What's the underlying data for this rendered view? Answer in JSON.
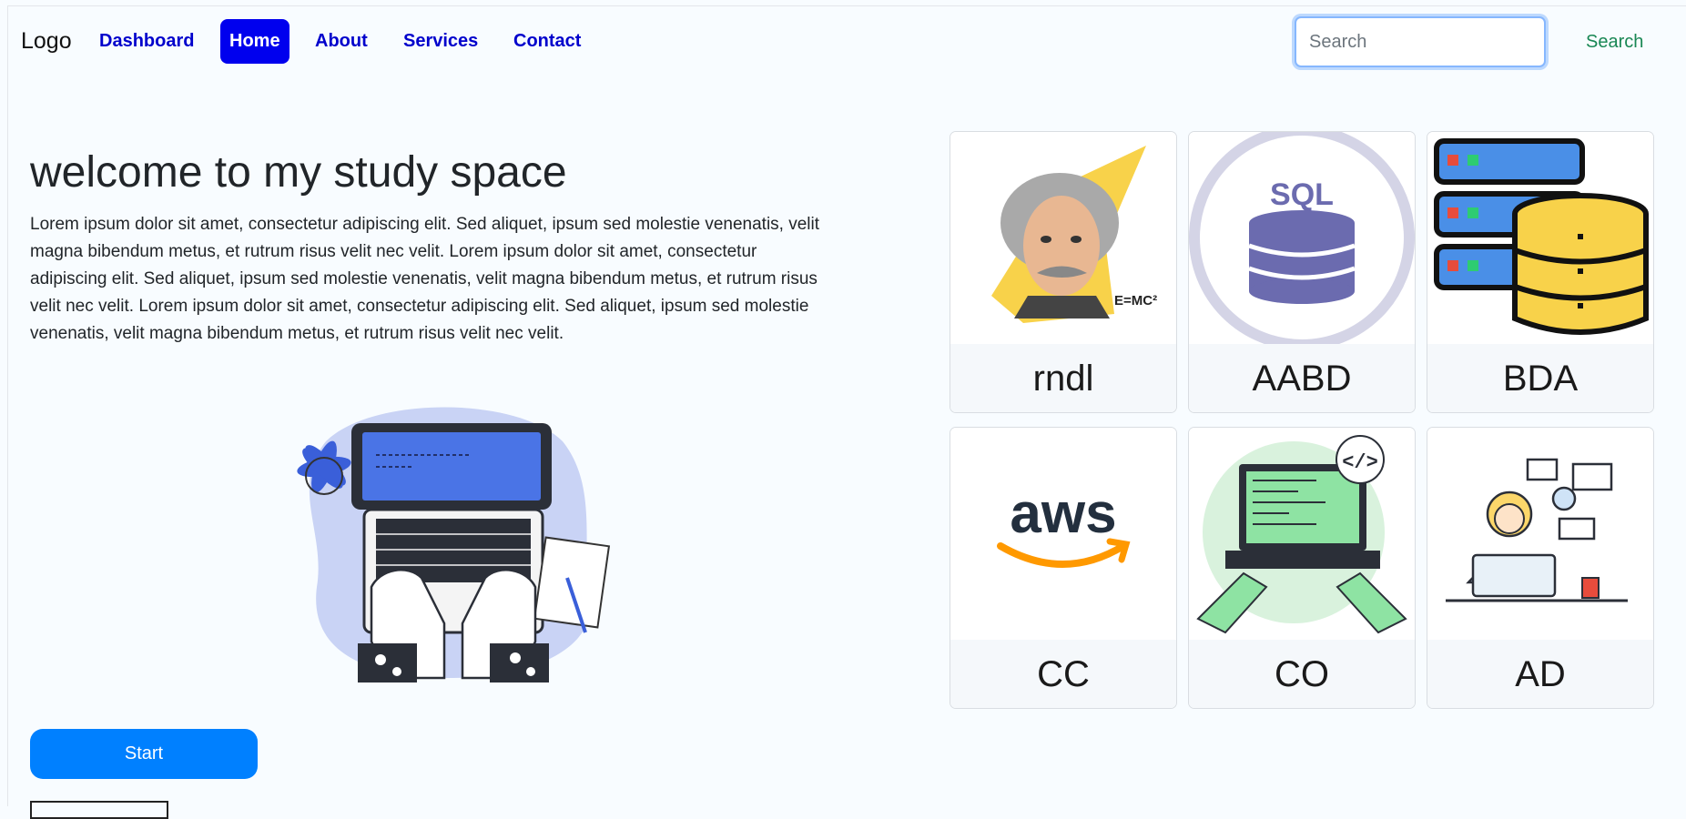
{
  "nav": {
    "logo": "Logo",
    "links": [
      {
        "label": "Dashboard",
        "active": false
      },
      {
        "label": "Home",
        "active": true
      },
      {
        "label": "About",
        "active": false
      },
      {
        "label": "Services",
        "active": false
      },
      {
        "label": "Contact",
        "active": false
      }
    ],
    "search_placeholder": "Search",
    "search_button": "Search"
  },
  "hero": {
    "title": "welcome to my study space",
    "text": "Lorem ipsum dolor sit amet, consectetur adipiscing elit. Sed aliquet, ipsum sed molestie venenatis, velit magna bibendum metus, et rutrum risus velit nec velit. Lorem ipsum dolor sit amet, consectetur adipiscing elit. Sed aliquet, ipsum sed molestie venenatis, velit magna bibendum metus, et rutrum risus velit nec velit. Lorem ipsum dolor sit amet, consectetur adipiscing elit. Sed aliquet, ipsum sed molestie venenatis, velit magna bibendum metus, et rutrum risus velit nec velit.",
    "start_button": "Start"
  },
  "cards": [
    {
      "label": "rndl",
      "icon": "einstein-icon"
    },
    {
      "label": "AABD",
      "icon": "sql-database-icon",
      "icon_text": "SQL"
    },
    {
      "label": "BDA",
      "icon": "server-database-icon"
    },
    {
      "label": "CC",
      "icon": "aws-logo-icon",
      "icon_text": "aws"
    },
    {
      "label": "CO",
      "icon": "coding-laptop-icon",
      "icon_text": "</>"
    },
    {
      "label": "AD",
      "icon": "workspace-person-icon"
    }
  ],
  "colors": {
    "nav_link": "#0000cc",
    "nav_active_bg": "#0000ee",
    "search_button": "#198754",
    "start_button": "#0080ff",
    "background": "#f8fcff"
  }
}
